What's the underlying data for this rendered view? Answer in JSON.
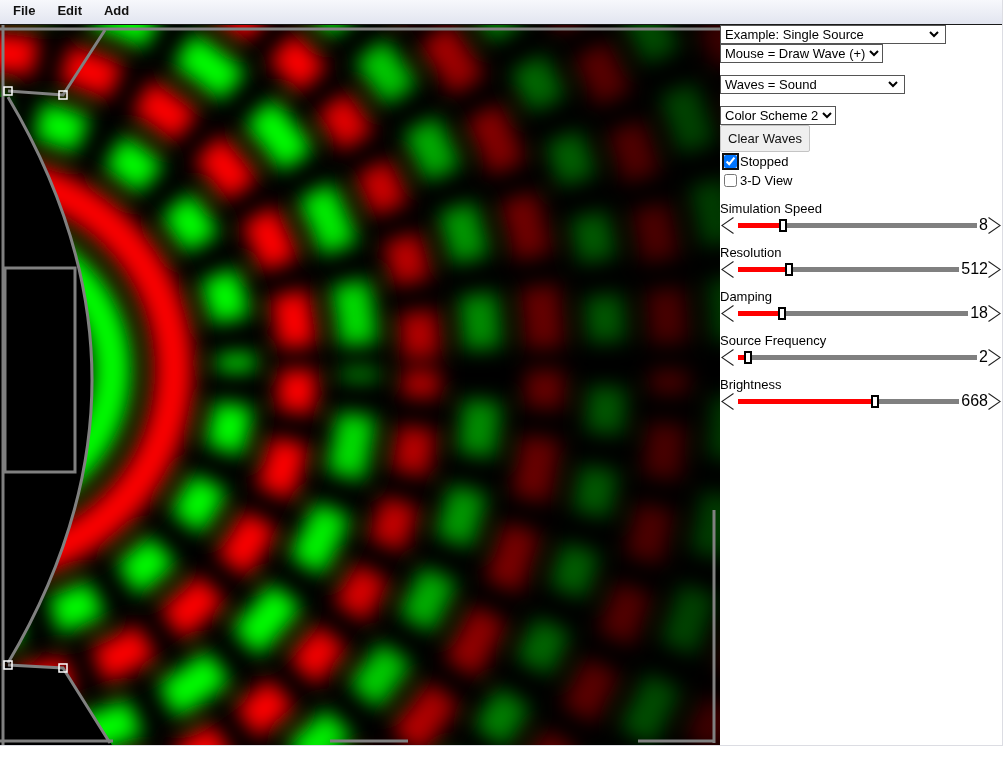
{
  "menu_bar": {
    "items": [
      "File",
      "Edit",
      "Add"
    ]
  },
  "controls": {
    "dropdowns": [
      {
        "value": "Example: Single Source"
      },
      {
        "value": "Mouse = Draw Wave (+)"
      },
      {
        "value": "Waves = Sound"
      },
      {
        "value": "Color Scheme 2"
      }
    ],
    "buttons": [
      "Clear Waves"
    ],
    "checkboxes": [
      {
        "label": "Stopped",
        "checked": true,
        "focused": true
      },
      {
        "label": "3-D View",
        "checked": false,
        "focused": false
      }
    ],
    "sliders": [
      {
        "label": "Simulation Speed",
        "level": 0.19,
        "reading": "8"
      },
      {
        "label": "Resolution",
        "level": 0.23,
        "reading": "512"
      },
      {
        "label": "Damping",
        "level": 0.19,
        "reading": "18"
      },
      {
        "label": "Source Frequency",
        "level": 0.04,
        "reading": "2"
      },
      {
        "label": "Brightness",
        "level": 0.62,
        "reading": "668"
      }
    ]
  }
}
